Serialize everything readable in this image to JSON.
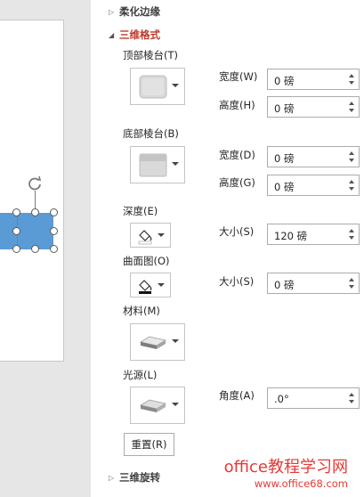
{
  "sections": {
    "soft_edges": "柔化边缘",
    "format_3d": "三维格式",
    "rotation_3d": "三维旋转"
  },
  "top_bevel": {
    "label": "顶部棱台(T)",
    "width_label": "宽度(W)",
    "width_value": "0 磅",
    "height_label": "高度(H)",
    "height_value": "0 磅"
  },
  "bottom_bevel": {
    "label": "底部棱台(B)",
    "width_label": "宽度(D)",
    "width_value": "0 磅",
    "height_label": "高度(G)",
    "height_value": "0 磅"
  },
  "depth": {
    "label": "深度(E)",
    "size_label": "大小(S)",
    "size_value": "120 磅"
  },
  "contour": {
    "label": "曲面图(O)",
    "size_label": "大小(S)",
    "size_value": "0 磅"
  },
  "material": {
    "label": "材料(M)"
  },
  "lighting": {
    "label": "光源(L)",
    "angle_label": "角度(A)",
    "angle_value": ".0°"
  },
  "reset_label": "重置(R)",
  "watermark": {
    "line1": "office教程学习网",
    "line2": "www.office68.com"
  },
  "colors": {
    "accent_heading": "#c0392b",
    "shape_fill": "#5b9bd5",
    "watermark": "#e53935"
  },
  "icons": [
    "collapse-triangle-icon",
    "expand-triangle-icon",
    "rotate-icon",
    "paint-bucket-icon",
    "bevel-preview-icon",
    "material-preview-icon",
    "lighting-preview-icon",
    "spinner-up-icon",
    "spinner-down-icon",
    "dropdown-arrow-icon"
  ]
}
